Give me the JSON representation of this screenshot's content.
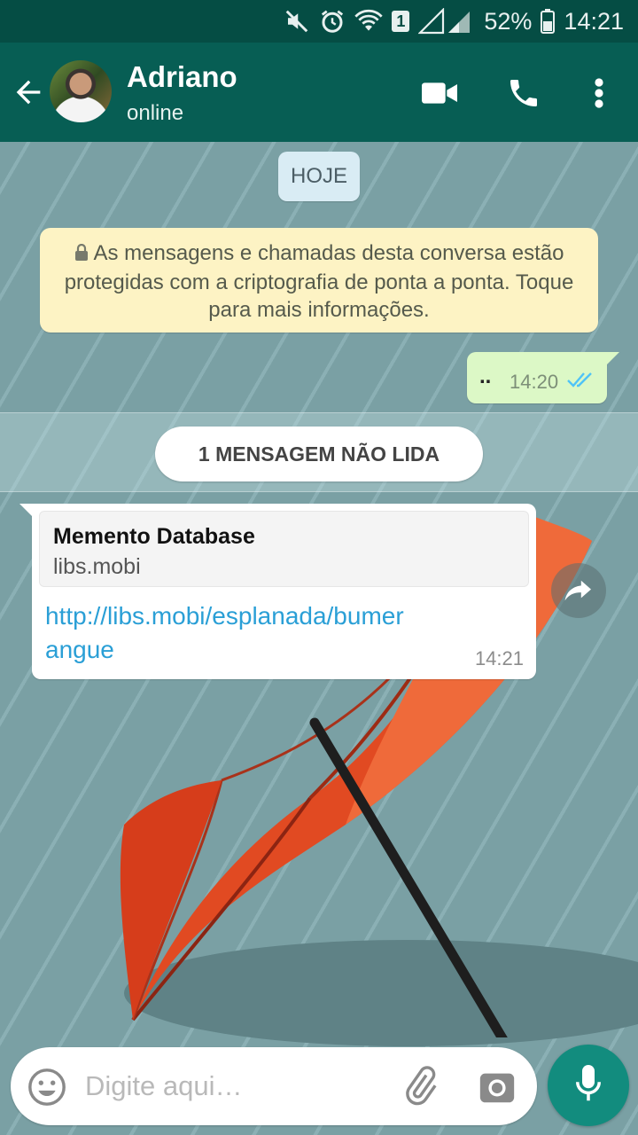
{
  "status_bar": {
    "sim_badge": "1",
    "battery": "52%",
    "time": "14:21"
  },
  "header": {
    "contact_name": "Adriano",
    "contact_status": "online",
    "icons": [
      "back-arrow-icon",
      "video-call-icon",
      "phone-icon",
      "more-vert-icon"
    ]
  },
  "chat": {
    "date_label": "HOJE",
    "encryption_notice": "As mensagens e chamadas desta conversa estão protegidas com a criptografia de ponta a ponta. Toque para mais informações.",
    "outgoing": {
      "text": "..",
      "time": "14:20",
      "status": "read"
    },
    "unread_banner": "1 MENSAGEM NÃO LIDA",
    "incoming": {
      "preview_title": "Memento Database",
      "preview_domain": "libs.mobi",
      "link": "http://libs.mobi/esplanada/bumerangue",
      "time": "14:21"
    }
  },
  "composer": {
    "placeholder": "Digite aqui…"
  },
  "colors": {
    "status_bar": "#054d44",
    "app_bar": "#075e54",
    "outgoing_bubble": "#dcf8c6",
    "encryption_notice": "#fdf3c4",
    "link": "#2a9fd6",
    "read_ticks": "#4fc3f7",
    "mic_button": "#128c7e"
  }
}
